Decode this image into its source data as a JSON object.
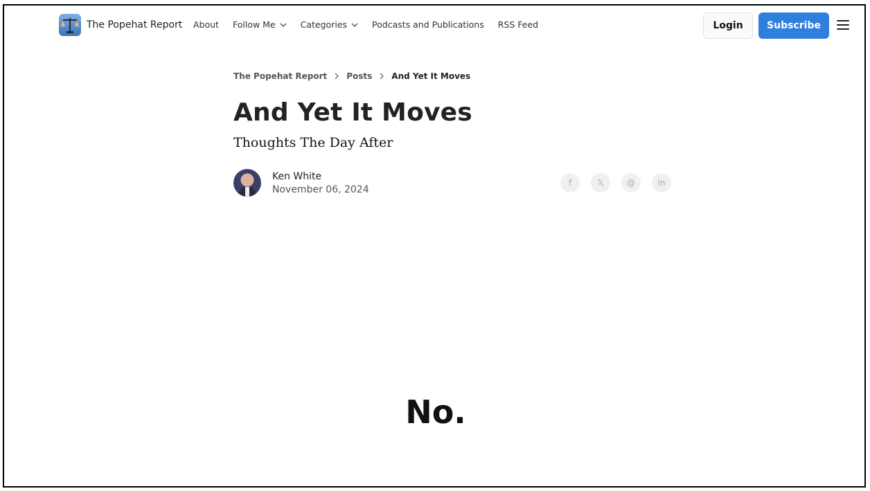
{
  "header": {
    "brand_title": "The Popehat Report",
    "nav": [
      {
        "label": "About",
        "has_dropdown": false
      },
      {
        "label": "Follow Me",
        "has_dropdown": true
      },
      {
        "label": "Categories",
        "has_dropdown": true
      },
      {
        "label": "Podcasts and Publications",
        "has_dropdown": false
      },
      {
        "label": "RSS Feed",
        "has_dropdown": false
      }
    ],
    "login_label": "Login",
    "subscribe_label": "Subscribe",
    "menu_icon": "hamburger-icon"
  },
  "breadcrumb": {
    "items": [
      "The Popehat Report",
      "Posts",
      "And Yet It Moves"
    ]
  },
  "post": {
    "title": "And Yet It Moves",
    "subtitle": "Thoughts The Day After",
    "author": "Ken White",
    "date": "November 06, 2024",
    "body_heading": "No."
  },
  "share": {
    "icons": [
      "facebook-icon",
      "x-icon",
      "threads-icon",
      "linkedin-icon"
    ],
    "glyphs": [
      "f",
      "𝕏",
      "@",
      "in"
    ]
  },
  "colors": {
    "accent": "#2f7fdc",
    "text": "#222222"
  }
}
